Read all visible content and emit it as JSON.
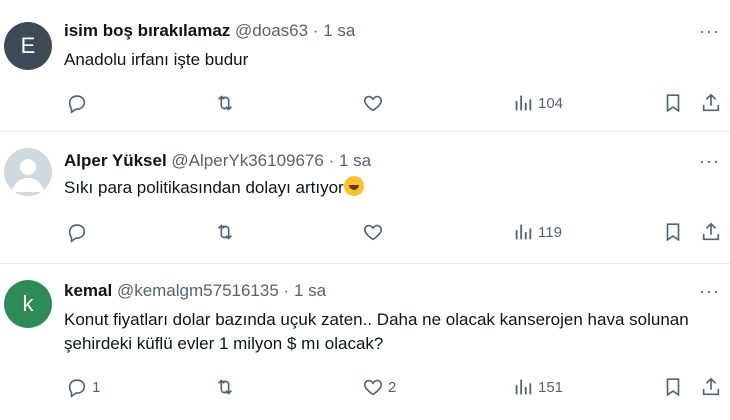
{
  "tweets": [
    {
      "avatar_letter": "E",
      "avatar_color": "#3d4a57",
      "name": "isim boş bırakılamaz",
      "handle": "@doas63",
      "dot": "·",
      "time": "1 sa",
      "more": "···",
      "text": "Anadolu irfanı işte budur",
      "reply_count": "",
      "retweet_count": "",
      "like_count": "",
      "views": "104"
    },
    {
      "avatar_letter": "",
      "avatar_color": "#cfd9de",
      "name": "Alper Yüksel",
      "handle": "@AlperYk36109676",
      "dot": "·",
      "time": "1 sa",
      "more": "···",
      "text": "Sıkı para politikasından dolayı artıyor",
      "emoji": "rolling-on-floor-laughing-emoji",
      "reply_count": "",
      "retweet_count": "",
      "like_count": "",
      "views": "119"
    },
    {
      "avatar_letter": "k",
      "avatar_color": "#2e8b57",
      "name": "kemal",
      "handle": "@kemalgm57516135",
      "dot": "·",
      "time": "1 sa",
      "more": "···",
      "text": "Konut fiyatları dolar bazında uçuk zaten.. Daha ne olacak kanserojen hava solunan şehirdeki  küflü evler 1 milyon $ mı olacak?",
      "reply_count": "1",
      "retweet_count": "",
      "like_count": "2",
      "views": "151"
    }
  ],
  "icons": {
    "reply": "reply-icon",
    "retweet": "retweet-icon",
    "like": "like-icon",
    "views": "views-icon",
    "bookmark": "bookmark-icon",
    "share": "share-icon"
  },
  "colors": {
    "icon_gray": "#536471",
    "separator": "#e6e9ec"
  }
}
